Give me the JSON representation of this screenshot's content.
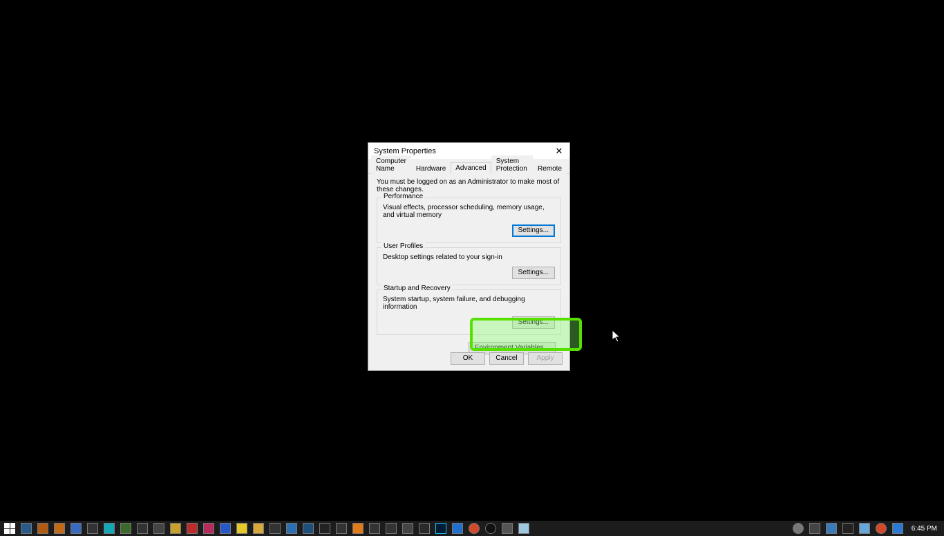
{
  "dialog": {
    "title": "System Properties",
    "tabs": {
      "computer_name": "Computer Name",
      "hardware": "Hardware",
      "advanced": "Advanced",
      "system_protection": "System Protection",
      "remote": "Remote"
    },
    "admin_note": "You must be logged on as an Administrator to make most of these changes.",
    "performance": {
      "legend": "Performance",
      "desc": "Visual effects, processor scheduling, memory usage, and virtual memory",
      "settings_label": "Settings..."
    },
    "user_profiles": {
      "legend": "User Profiles",
      "desc": "Desktop settings related to your sign-in",
      "settings_label": "Settings..."
    },
    "startup_recovery": {
      "legend": "Startup and Recovery",
      "desc": "System startup, system failure, and debugging information",
      "settings_label": "Settings..."
    },
    "env_vars_label": "Environment Variables...",
    "ok_label": "OK",
    "cancel_label": "Cancel",
    "apply_label": "Apply"
  },
  "taskbar": {
    "clock": "6:45 PM"
  }
}
